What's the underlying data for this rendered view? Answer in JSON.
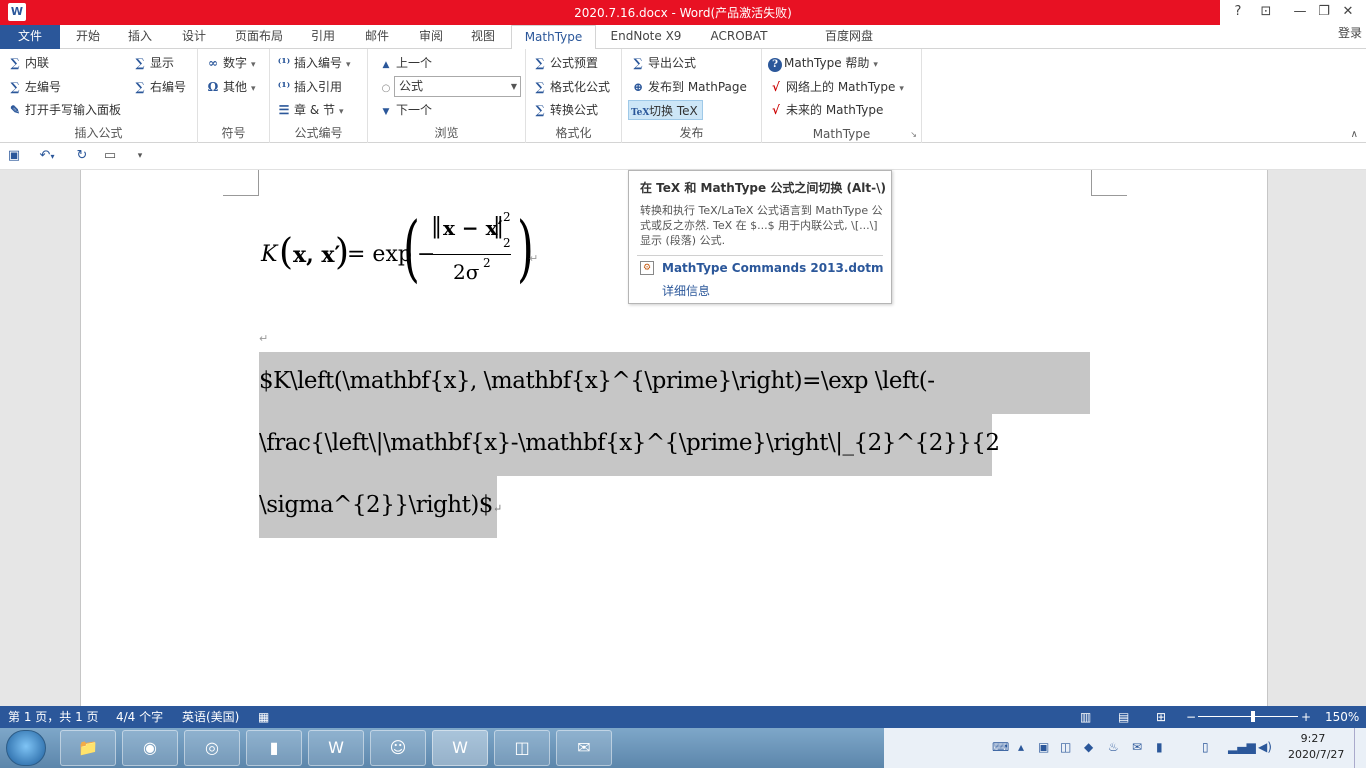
{
  "window": {
    "title": "2020.7.16.docx -  Word(产品激活失败)",
    "app_icon": "W",
    "controls": {
      "help": "?",
      "ribbon_display": "⊡",
      "minimize": "—",
      "restore": "❐",
      "close": "✕"
    }
  },
  "tabs": {
    "file": "文件",
    "items": [
      "开始",
      "插入",
      "设计",
      "页面布局",
      "引用",
      "邮件",
      "审阅",
      "视图",
      "MathType",
      "EndNote X9",
      "ACROBAT",
      "百度网盘"
    ],
    "active": "MathType",
    "login": "登录"
  },
  "ribbon": {
    "group_insert": {
      "label": "插入公式",
      "items": [
        "内联",
        "左编号",
        "打开手写输入面板",
        "显示",
        "右编号"
      ]
    },
    "group_symbol": {
      "label": "符号",
      "items": [
        "数字",
        "其他"
      ]
    },
    "group_numbering": {
      "label": "公式编号",
      "items": [
        "插入编号",
        "插入引用",
        "章 & 节"
      ]
    },
    "group_browse": {
      "label": "浏览",
      "prev": "上一个",
      "combo_value": "公式",
      "next": "下一个"
    },
    "group_format": {
      "label": "格式化",
      "items": [
        "公式预置",
        "格式化公式",
        "转换公式"
      ]
    },
    "group_publish": {
      "label": "发布",
      "items": [
        "导出公式",
        "发布到 MathPage",
        "切换 TeX"
      ]
    },
    "group_mathtype": {
      "label": "MathType",
      "items": [
        "MathType 帮助",
        "网络上的 MathType",
        "未来的 MathType"
      ]
    }
  },
  "tooltip": {
    "title": "在 TeX 和 MathType 公式之间切换 (Alt-\\)",
    "description": "转换和执行 TeX/LaTeX 公式语言到 MathType 公式或反之亦然. TeX 在 $...$ 用于内联公式, \\[...\\] 显示 (段落) 公式.",
    "link": "MathType Commands 2013.dotm",
    "more": "详细信息"
  },
  "document": {
    "formula": {
      "lhs": "K",
      "args": "x, x′",
      "fn": "= exp",
      "minus": "−",
      "numerator": "x − x′",
      "norm_sub": "2",
      "norm_sup": "2",
      "denominator": "2σ",
      "den_sup": "2"
    },
    "tex_lines": [
      "$K\\left(\\mathbf{x},             \\mathbf{x}^{\\prime}\\right)=\\exp             \\left(-",
      "\\frac{\\left\\|\\mathbf{x}-\\mathbf{x}^{\\prime}\\right\\|_{2}^{2}}{2",
      "\\sigma^{2}}\\right)$"
    ],
    "para_mark": "↵"
  },
  "statusbar": {
    "page": "第 1 页，共 1 页",
    "words": "4/4 个字",
    "language": "英语(美国)",
    "zoom": "150%",
    "zoom_level": 0.55
  },
  "taskbar": {
    "apps": [
      "explorer",
      "camera",
      "chrome",
      "reader",
      "wps",
      "photo",
      "word",
      "app",
      "wechat"
    ],
    "time": "9:27",
    "date": "2020/7/27"
  }
}
